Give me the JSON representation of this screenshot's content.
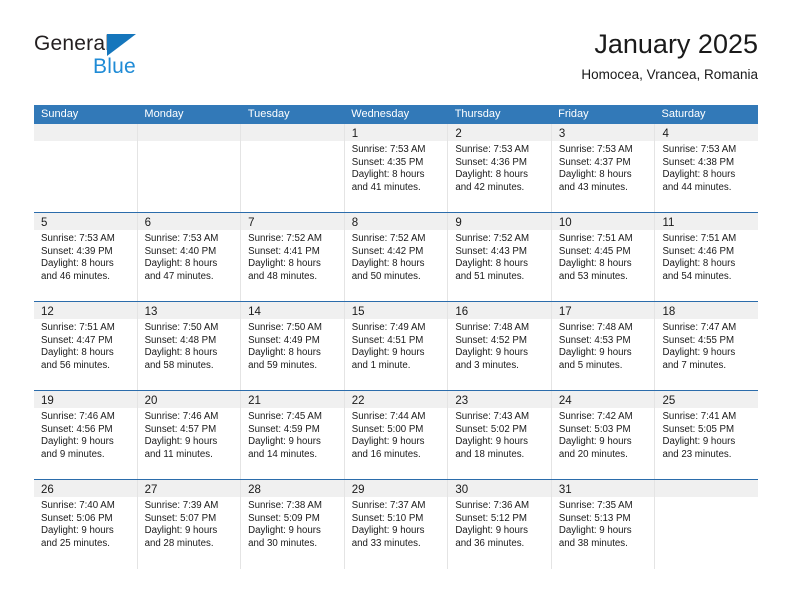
{
  "brand": {
    "name_dark": "General",
    "name_blue": "Blue",
    "accent_blue": "#1f8bd6",
    "triangle_blue": "#1576bc"
  },
  "header": {
    "title": "January 2025",
    "subtitle": "Homocea, Vrancea, Romania",
    "header_bg": "#3279b8",
    "row_divider": "#2b6cab",
    "daynum_band": "#f0f0f0"
  },
  "weekdays": [
    "Sunday",
    "Monday",
    "Tuesday",
    "Wednesday",
    "Thursday",
    "Friday",
    "Saturday"
  ],
  "weeks": [
    [
      {
        "day": "",
        "lines": []
      },
      {
        "day": "",
        "lines": []
      },
      {
        "day": "",
        "lines": []
      },
      {
        "day": "1",
        "lines": [
          "Sunrise: 7:53 AM",
          "Sunset: 4:35 PM",
          "Daylight: 8 hours",
          "and 41 minutes."
        ]
      },
      {
        "day": "2",
        "lines": [
          "Sunrise: 7:53 AM",
          "Sunset: 4:36 PM",
          "Daylight: 8 hours",
          "and 42 minutes."
        ]
      },
      {
        "day": "3",
        "lines": [
          "Sunrise: 7:53 AM",
          "Sunset: 4:37 PM",
          "Daylight: 8 hours",
          "and 43 minutes."
        ]
      },
      {
        "day": "4",
        "lines": [
          "Sunrise: 7:53 AM",
          "Sunset: 4:38 PM",
          "Daylight: 8 hours",
          "and 44 minutes."
        ]
      }
    ],
    [
      {
        "day": "5",
        "lines": [
          "Sunrise: 7:53 AM",
          "Sunset: 4:39 PM",
          "Daylight: 8 hours",
          "and 46 minutes."
        ]
      },
      {
        "day": "6",
        "lines": [
          "Sunrise: 7:53 AM",
          "Sunset: 4:40 PM",
          "Daylight: 8 hours",
          "and 47 minutes."
        ]
      },
      {
        "day": "7",
        "lines": [
          "Sunrise: 7:52 AM",
          "Sunset: 4:41 PM",
          "Daylight: 8 hours",
          "and 48 minutes."
        ]
      },
      {
        "day": "8",
        "lines": [
          "Sunrise: 7:52 AM",
          "Sunset: 4:42 PM",
          "Daylight: 8 hours",
          "and 50 minutes."
        ]
      },
      {
        "day": "9",
        "lines": [
          "Sunrise: 7:52 AM",
          "Sunset: 4:43 PM",
          "Daylight: 8 hours",
          "and 51 minutes."
        ]
      },
      {
        "day": "10",
        "lines": [
          "Sunrise: 7:51 AM",
          "Sunset: 4:45 PM",
          "Daylight: 8 hours",
          "and 53 minutes."
        ]
      },
      {
        "day": "11",
        "lines": [
          "Sunrise: 7:51 AM",
          "Sunset: 4:46 PM",
          "Daylight: 8 hours",
          "and 54 minutes."
        ]
      }
    ],
    [
      {
        "day": "12",
        "lines": [
          "Sunrise: 7:51 AM",
          "Sunset: 4:47 PM",
          "Daylight: 8 hours",
          "and 56 minutes."
        ]
      },
      {
        "day": "13",
        "lines": [
          "Sunrise: 7:50 AM",
          "Sunset: 4:48 PM",
          "Daylight: 8 hours",
          "and 58 minutes."
        ]
      },
      {
        "day": "14",
        "lines": [
          "Sunrise: 7:50 AM",
          "Sunset: 4:49 PM",
          "Daylight: 8 hours",
          "and 59 minutes."
        ]
      },
      {
        "day": "15",
        "lines": [
          "Sunrise: 7:49 AM",
          "Sunset: 4:51 PM",
          "Daylight: 9 hours",
          "and 1 minute."
        ]
      },
      {
        "day": "16",
        "lines": [
          "Sunrise: 7:48 AM",
          "Sunset: 4:52 PM",
          "Daylight: 9 hours",
          "and 3 minutes."
        ]
      },
      {
        "day": "17",
        "lines": [
          "Sunrise: 7:48 AM",
          "Sunset: 4:53 PM",
          "Daylight: 9 hours",
          "and 5 minutes."
        ]
      },
      {
        "day": "18",
        "lines": [
          "Sunrise: 7:47 AM",
          "Sunset: 4:55 PM",
          "Daylight: 9 hours",
          "and 7 minutes."
        ]
      }
    ],
    [
      {
        "day": "19",
        "lines": [
          "Sunrise: 7:46 AM",
          "Sunset: 4:56 PM",
          "Daylight: 9 hours",
          "and 9 minutes."
        ]
      },
      {
        "day": "20",
        "lines": [
          "Sunrise: 7:46 AM",
          "Sunset: 4:57 PM",
          "Daylight: 9 hours",
          "and 11 minutes."
        ]
      },
      {
        "day": "21",
        "lines": [
          "Sunrise: 7:45 AM",
          "Sunset: 4:59 PM",
          "Daylight: 9 hours",
          "and 14 minutes."
        ]
      },
      {
        "day": "22",
        "lines": [
          "Sunrise: 7:44 AM",
          "Sunset: 5:00 PM",
          "Daylight: 9 hours",
          "and 16 minutes."
        ]
      },
      {
        "day": "23",
        "lines": [
          "Sunrise: 7:43 AM",
          "Sunset: 5:02 PM",
          "Daylight: 9 hours",
          "and 18 minutes."
        ]
      },
      {
        "day": "24",
        "lines": [
          "Sunrise: 7:42 AM",
          "Sunset: 5:03 PM",
          "Daylight: 9 hours",
          "and 20 minutes."
        ]
      },
      {
        "day": "25",
        "lines": [
          "Sunrise: 7:41 AM",
          "Sunset: 5:05 PM",
          "Daylight: 9 hours",
          "and 23 minutes."
        ]
      }
    ],
    [
      {
        "day": "26",
        "lines": [
          "Sunrise: 7:40 AM",
          "Sunset: 5:06 PM",
          "Daylight: 9 hours",
          "and 25 minutes."
        ]
      },
      {
        "day": "27",
        "lines": [
          "Sunrise: 7:39 AM",
          "Sunset: 5:07 PM",
          "Daylight: 9 hours",
          "and 28 minutes."
        ]
      },
      {
        "day": "28",
        "lines": [
          "Sunrise: 7:38 AM",
          "Sunset: 5:09 PM",
          "Daylight: 9 hours",
          "and 30 minutes."
        ]
      },
      {
        "day": "29",
        "lines": [
          "Sunrise: 7:37 AM",
          "Sunset: 5:10 PM",
          "Daylight: 9 hours",
          "and 33 minutes."
        ]
      },
      {
        "day": "30",
        "lines": [
          "Sunrise: 7:36 AM",
          "Sunset: 5:12 PM",
          "Daylight: 9 hours",
          "and 36 minutes."
        ]
      },
      {
        "day": "31",
        "lines": [
          "Sunrise: 7:35 AM",
          "Sunset: 5:13 PM",
          "Daylight: 9 hours",
          "and 38 minutes."
        ]
      },
      {
        "day": "",
        "lines": []
      }
    ]
  ]
}
